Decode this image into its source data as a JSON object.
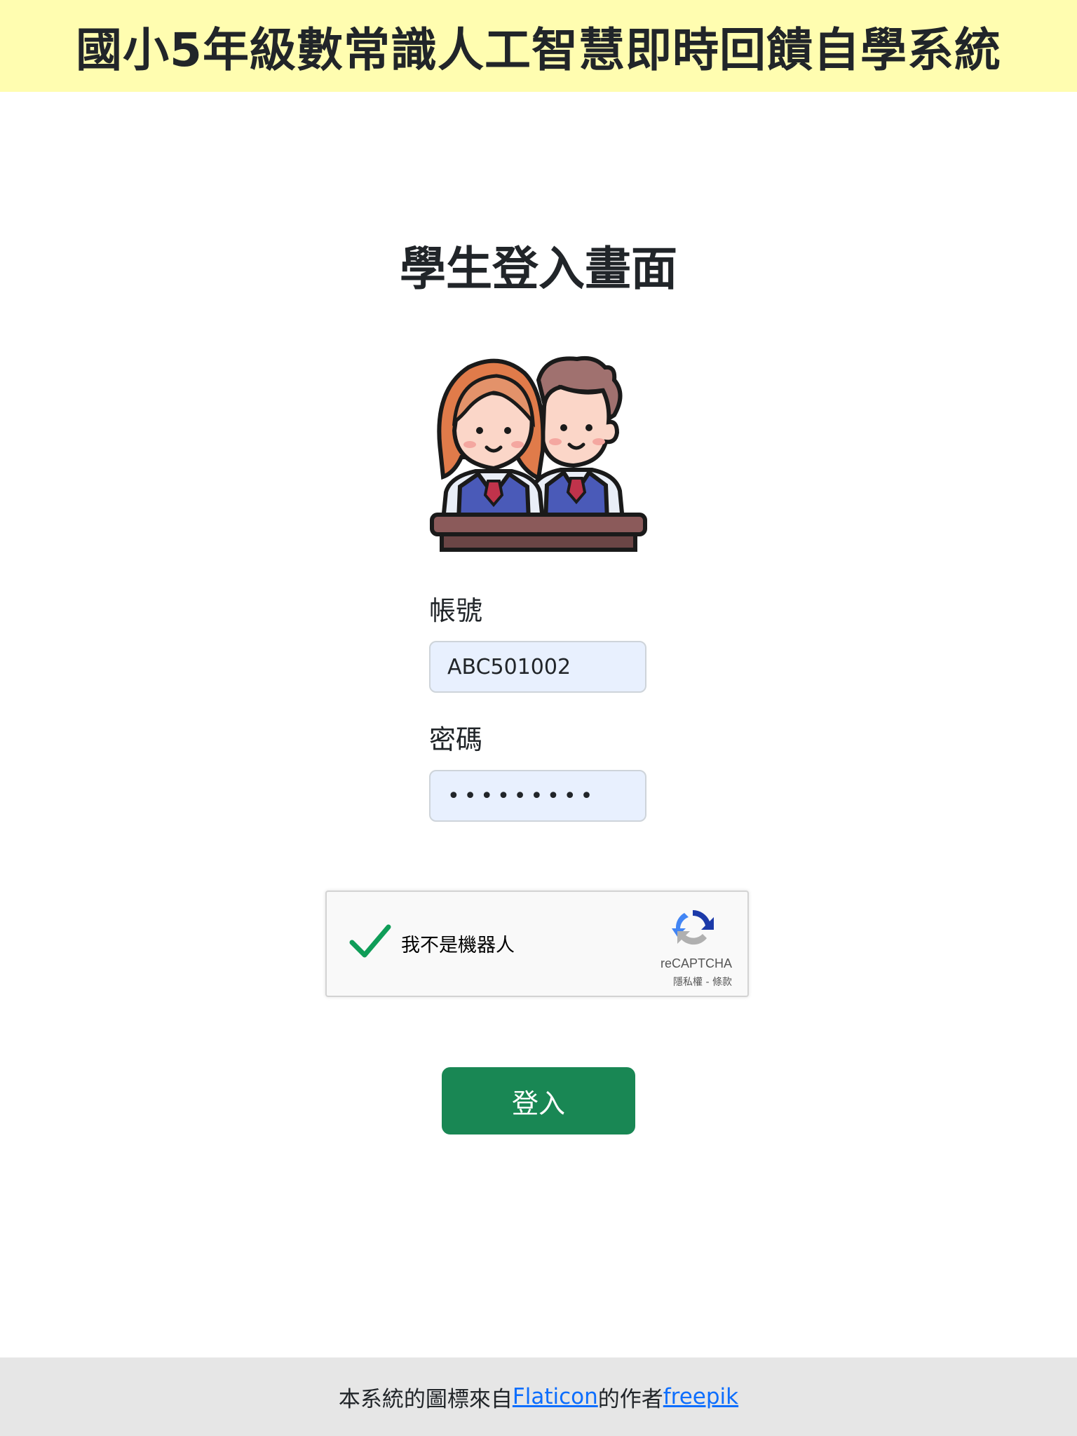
{
  "header": {
    "title": "國小5年級數常識人工智慧即時回饋自學系統"
  },
  "login": {
    "title": "學生登入畫面",
    "illustration_icon": "students-at-desk-icon",
    "account_label": "帳號",
    "account_value": "ABC501002",
    "password_label": "密碼",
    "password_value": "•••••••••",
    "submit_label": "登入"
  },
  "recaptcha": {
    "label": "我不是機器人",
    "checked": true,
    "brand": "reCAPTCHA",
    "terms": "隱私權 - 條款",
    "logo_icon": "recaptcha-logo-icon",
    "check_icon": "checkmark-icon"
  },
  "footer": {
    "text_before": "本系統的圖標來自",
    "flaticon_link": "Flaticon",
    "text_middle": "的作者",
    "freepik_link": "freepik"
  },
  "colors": {
    "header_bg": "#fffdb0",
    "input_bg": "#e8f0fe",
    "button_bg": "#198754",
    "check_green": "#0f9d58",
    "link": "#0d6efd",
    "footer_bg": "#e6e6e6"
  }
}
